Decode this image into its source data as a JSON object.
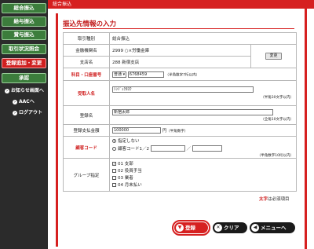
{
  "header": {
    "title": "総合振込"
  },
  "sidebar": {
    "items": [
      {
        "label": "総合振込"
      },
      {
        "label": "給与振込"
      },
      {
        "label": "賞与振込"
      },
      {
        "label": "取引状況照会"
      },
      {
        "label": "登録追加・変更"
      },
      {
        "label": "承認"
      }
    ],
    "links": [
      {
        "label": "お知らせ画面へ"
      },
      {
        "label": "AACへ"
      },
      {
        "label": "ログアウト"
      }
    ]
  },
  "page": {
    "title": "振込先情報の入力"
  },
  "form": {
    "transaction_type": {
      "label": "取引種別",
      "value": "総合振込"
    },
    "bank_name": {
      "label": "金融機関名",
      "value": "2999 ○×労働金庫"
    },
    "branch_name": {
      "label": "支店名",
      "value": "288 新宿支店"
    },
    "change_button": "変更",
    "account": {
      "label": "科目・口座番号",
      "type_value": "普通",
      "number_value": "6768459",
      "note": "（半角数字7桁以内）"
    },
    "recipient": {
      "label": "受取人名",
      "value": "ｼﾝｼﾞｭｸﾀﾛｳ",
      "note": "（半角30文字以内）"
    },
    "registered_name": {
      "label": "登録名",
      "value": "新宿太郎",
      "note": "（全角10文字以内）"
    },
    "amount": {
      "label": "登録支払金額",
      "value": "100000",
      "unit": "円",
      "note": "（半角数字）"
    },
    "customer_code": {
      "label": "顧客コード",
      "option_none": "指定しない",
      "option_code": "顧客コード1／2",
      "separator": "／",
      "note": "（半角数字10桁以内）"
    },
    "group": {
      "label": "グループ指定",
      "options": [
        {
          "label": "01 支部",
          "checked": true
        },
        {
          "label": "02 役員手当",
          "checked": false
        },
        {
          "label": "03 業者",
          "checked": false
        },
        {
          "label": "04 月末払い",
          "checked": false
        }
      ]
    }
  },
  "required_note": {
    "mark": "太字",
    "text": "は必須項目"
  },
  "actions": {
    "register": "登録",
    "clear": "クリア",
    "menu": "メニューへ"
  },
  "colors": {
    "accent": "#d62020",
    "nav_green": "#3c7d3c",
    "sidebar_bg": "#2b2b2b"
  }
}
